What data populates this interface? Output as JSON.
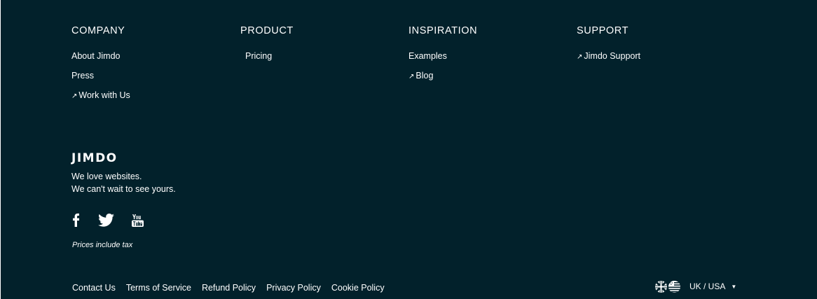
{
  "columns": {
    "company": {
      "heading": "COMPANY",
      "links": [
        "About Jimdo",
        "Press",
        "Work with Us"
      ]
    },
    "product": {
      "heading": "PRODUCT",
      "links": [
        "Pricing"
      ]
    },
    "inspiration": {
      "heading": "INSPIRATION",
      "links": [
        "Examples",
        "Blog"
      ]
    },
    "support": {
      "heading": "SUPPORT",
      "links": [
        "Jimdo Support"
      ]
    }
  },
  "external_link_glyph": "↗",
  "brand": {
    "logo": "JIMDO",
    "tagline_1": "We love websites.",
    "tagline_2": "We can't wait to see yours."
  },
  "social": {
    "icons": [
      "facebook-icon",
      "twitter-icon",
      "youtube-icon"
    ]
  },
  "tax_note": "Prices include tax",
  "legal": {
    "links": [
      "Contact Us",
      "Terms of Service",
      "Refund Policy",
      "Privacy Policy",
      "Cookie Policy"
    ]
  },
  "locale": {
    "label": "UK / USA",
    "flags": [
      "uk-flag-icon",
      "usa-flag-icon"
    ],
    "caret": "▼"
  },
  "colors": {
    "background": "#02212b",
    "text": "#ffffff"
  }
}
